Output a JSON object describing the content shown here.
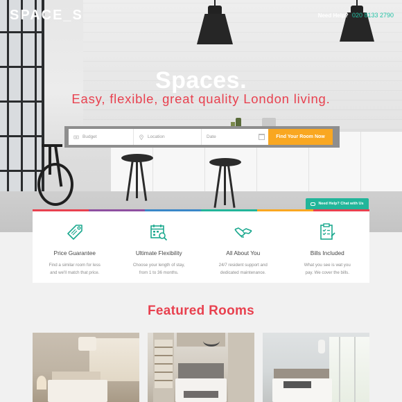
{
  "header": {
    "logo": "SPACE_S",
    "help_label": "Need Help?",
    "help_phone": "020 8133 2790"
  },
  "hero": {
    "title": "Spaces.",
    "subtitle": "Easy, flexible, great quality London living."
  },
  "search": {
    "budget_placeholder": "Budget",
    "location_placeholder": "Location",
    "date_placeholder": "Date",
    "submit_label": "Find Your Room Now"
  },
  "chat": {
    "label": "Need Help? Chat with Us"
  },
  "colors": {
    "accent_red": "#e8414f",
    "accent_teal": "#22b59a",
    "button_orange": "#f9a721",
    "rainbow": [
      "#e8414f",
      "#8e4fa0",
      "#3a87c8",
      "#22b59a",
      "#f9a721",
      "#e8414f"
    ]
  },
  "features": [
    {
      "icon": "price-tag-icon",
      "title": "Price Guarantee",
      "line1": "Find a similar room for less",
      "line2": "and we'll match that price."
    },
    {
      "icon": "calendar-search-icon",
      "title": "Ultimate Flexibility",
      "line1": "Choose your length of stay,",
      "line2": "from 1 to 36 months."
    },
    {
      "icon": "handshake-icon",
      "title": "All About You",
      "line1": "24/7 resident support and",
      "line2": "dedicated maintenance."
    },
    {
      "icon": "checklist-icon",
      "title": "Bills Included",
      "line1": "What you see is wat you",
      "line2": "pay. We cover the bills."
    }
  ],
  "featured": {
    "title": "Featured Rooms",
    "rooms": [
      {
        "image": "bedroom-photo-1"
      },
      {
        "image": "bedroom-photo-2"
      },
      {
        "image": "bedroom-photo-3"
      }
    ]
  }
}
